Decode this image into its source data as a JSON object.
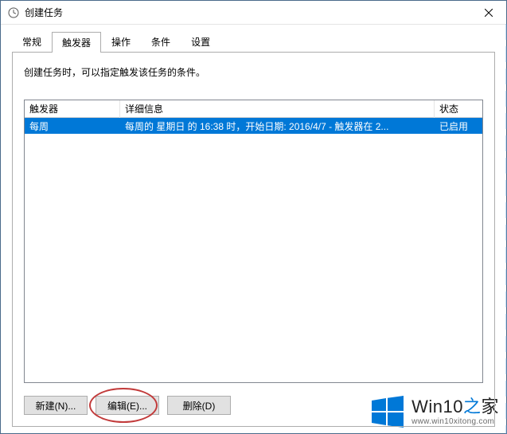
{
  "window": {
    "title": "创建任务",
    "icon": "clock-icon"
  },
  "tabs": [
    {
      "label": "常规"
    },
    {
      "label": "触发器"
    },
    {
      "label": "操作"
    },
    {
      "label": "条件"
    },
    {
      "label": "设置"
    }
  ],
  "active_tab_index": 1,
  "description": "创建任务时，可以指定触发该任务的条件。",
  "columns": {
    "trigger": "触发器",
    "detail": "详细信息",
    "status": "状态"
  },
  "rows": [
    {
      "trigger": "每周",
      "detail": "每周的 星期日 的 16:38 时，开始日期: 2016/4/7 - 触发器在 2...",
      "status": "已启用",
      "selected": true
    }
  ],
  "buttons": {
    "new": "新建(N)...",
    "edit": "编辑(E)...",
    "delete": "删除(D)"
  },
  "highlighted_button": "edit",
  "watermark": {
    "brand_prefix": "Win10",
    "brand_mid": "之",
    "brand_suffix": "家",
    "url": "www.win10xitong.com"
  }
}
